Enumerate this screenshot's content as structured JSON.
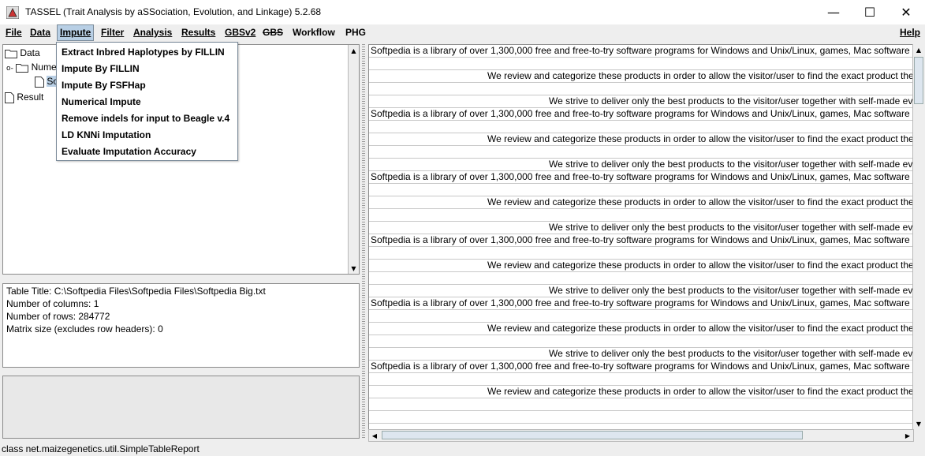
{
  "window": {
    "title": "TASSEL (Trait Analysis by aSSociation, Evolution, and Linkage) 5.2.68",
    "minimize_glyph": "—",
    "maximize_glyph": "☐",
    "close_glyph": "✕"
  },
  "menubar": {
    "file": "File",
    "data": "Data",
    "impute": "Impute",
    "filter": "Filter",
    "analysis": "Analysis",
    "results": "Results",
    "gbsv2": "GBSv2",
    "gbs": "GBS",
    "workflow": "Workflow",
    "phg": "PHG",
    "help": "Help"
  },
  "impute_menu": {
    "items": [
      "Extract Inbred Haplotypes by FILLIN",
      "Impute By FILLIN",
      "Impute By FSFHap",
      "Numerical Impute",
      "Remove indels for input to Beagle v.4",
      "LD KNNi Imputation",
      "Evaluate Imputation Accuracy"
    ]
  },
  "tree": {
    "data": "Data",
    "numeric": "Numeric",
    "child": "Softpedia",
    "result": "Result"
  },
  "info": {
    "lines": [
      "Table Title: C:\\Softpedia Files\\Softpedia Files\\Softpedia Big.txt",
      "Number of columns: 1",
      "Number of rows: 284772",
      "Matrix size (excludes row headers): 0"
    ]
  },
  "table": {
    "rows": [
      {
        "text": "Softpedia is a library of over 1,300,000 free and free-to-try software programs for Windows and Unix/Linux, games, Mac software",
        "align": "left"
      },
      {
        "text": "",
        "align": "left"
      },
      {
        "text": "We review and categorize these products in order to allow the visitor/user to find the exact product they",
        "align": "mid"
      },
      {
        "text": "",
        "align": "left"
      },
      {
        "text": "We strive to deliver only the best products to the visitor/user together with self-made eva",
        "align": "right"
      },
      {
        "text": "Softpedia is a library of over 1,300,000 free and free-to-try software programs for Windows and Unix/Linux, games, Mac software",
        "align": "left"
      },
      {
        "text": "",
        "align": "left"
      },
      {
        "text": "We review and categorize these products in order to allow the visitor/user to find the exact product they",
        "align": "mid"
      },
      {
        "text": "",
        "align": "left"
      },
      {
        "text": "We strive to deliver only the best products to the visitor/user together with self-made eva",
        "align": "right"
      },
      {
        "text": "Softpedia is a library of over 1,300,000 free and free-to-try software programs for Windows and Unix/Linux, games, Mac software",
        "align": "left"
      },
      {
        "text": "",
        "align": "left"
      },
      {
        "text": "We review and categorize these products in order to allow the visitor/user to find the exact product they",
        "align": "mid"
      },
      {
        "text": "",
        "align": "left"
      },
      {
        "text": "We strive to deliver only the best products to the visitor/user together with self-made eva",
        "align": "right"
      },
      {
        "text": "Softpedia is a library of over 1,300,000 free and free-to-try software programs for Windows and Unix/Linux, games, Mac software",
        "align": "left"
      },
      {
        "text": "",
        "align": "left"
      },
      {
        "text": "We review and categorize these products in order to allow the visitor/user to find the exact product they",
        "align": "mid"
      },
      {
        "text": "",
        "align": "left"
      },
      {
        "text": "We strive to deliver only the best products to the visitor/user together with self-made eva",
        "align": "right"
      },
      {
        "text": "Softpedia is a library of over 1,300,000 free and free-to-try software programs for Windows and Unix/Linux, games, Mac software",
        "align": "left"
      },
      {
        "text": "",
        "align": "left"
      },
      {
        "text": "We review and categorize these products in order to allow the visitor/user to find the exact product they",
        "align": "mid"
      },
      {
        "text": "",
        "align": "left"
      },
      {
        "text": "We strive to deliver only the best products to the visitor/user together with self-made eva",
        "align": "right"
      },
      {
        "text": "Softpedia is a library of over 1,300,000 free and free-to-try software programs for Windows and Unix/Linux, games, Mac software",
        "align": "left"
      },
      {
        "text": "",
        "align": "left"
      },
      {
        "text": "We review and categorize these products in order to allow the visitor/user to find the exact product they",
        "align": "mid"
      },
      {
        "text": "",
        "align": "left"
      },
      {
        "text": "",
        "align": "left"
      }
    ]
  },
  "statusbar": {
    "text": "class net.maizegenetics.util.SimpleTableReport"
  },
  "colors": {
    "menu_active": "#b8cfe5",
    "background": "#eeeeee"
  },
  "icons": {
    "app": "tassel-app-icon",
    "folder": "folder-icon",
    "file": "file-icon"
  }
}
